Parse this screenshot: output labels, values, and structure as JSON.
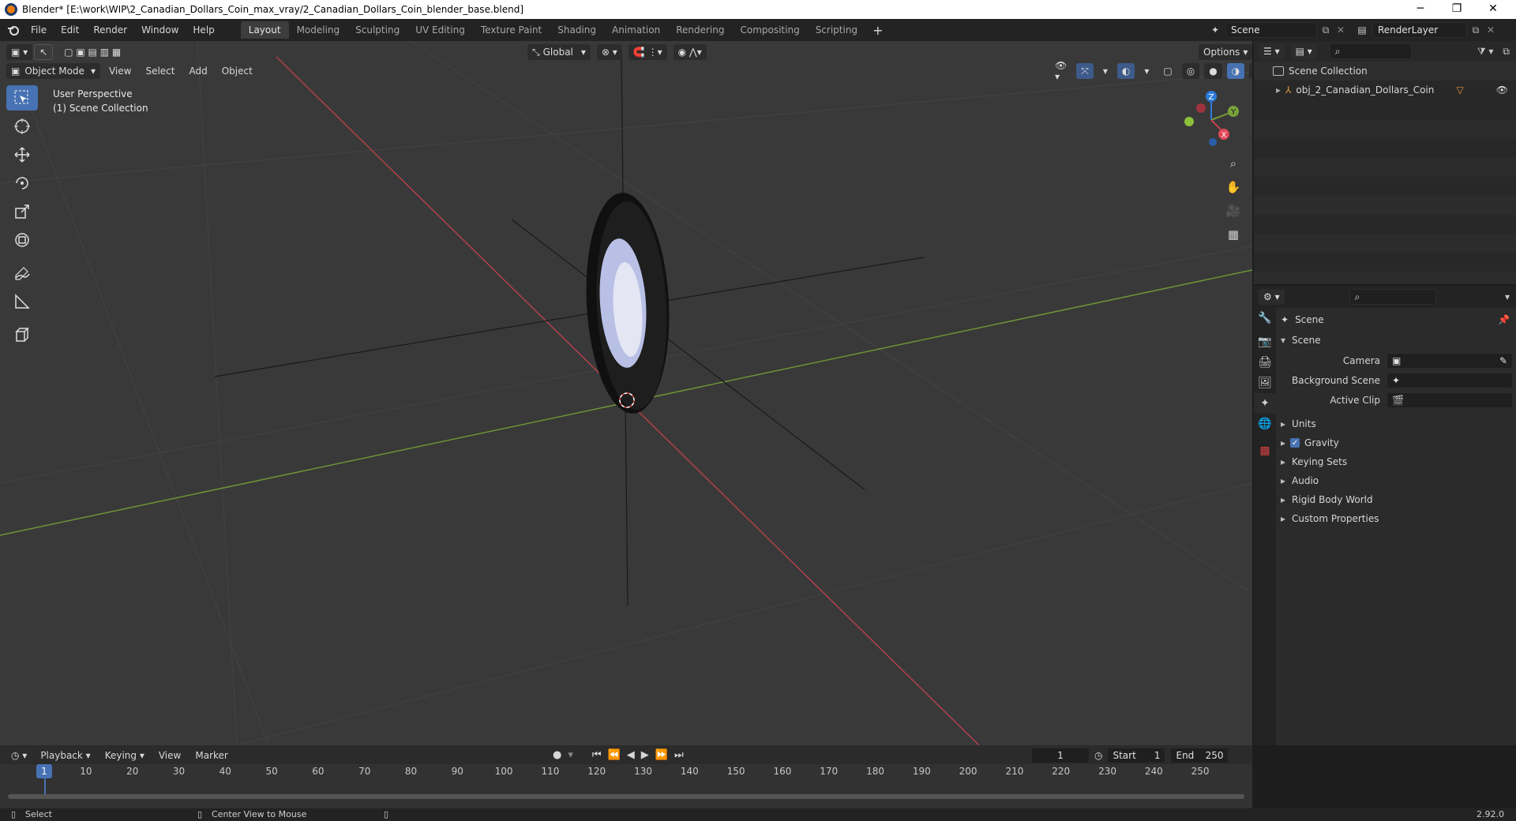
{
  "window": {
    "title": "Blender* [E:\\work\\WIP\\2_Canadian_Dollars_Coin_max_vray/2_Canadian_Dollars_Coin_blender_base.blend]"
  },
  "menu": [
    "File",
    "Edit",
    "Render",
    "Window",
    "Help"
  ],
  "workspaces": [
    "Layout",
    "Modeling",
    "Sculpting",
    "UV Editing",
    "Texture Paint",
    "Shading",
    "Animation",
    "Rendering",
    "Compositing",
    "Scripting"
  ],
  "scene_name": "Scene",
  "view_layer": "RenderLayer",
  "viewport": {
    "mode": "Object Mode",
    "menus": [
      "View",
      "Select",
      "Add",
      "Object"
    ],
    "transform_orientation": "Global",
    "options_label": "Options",
    "overlay_line1": "User Perspective",
    "overlay_line2": "(1) Scene Collection",
    "gizmo_axes": {
      "z": "Z",
      "y": "Y",
      "x": "X"
    }
  },
  "outliner": {
    "root": "Scene Collection",
    "items": [
      {
        "label": "obj_2_Canadian_Dollars_Coin"
      }
    ]
  },
  "properties": {
    "header": "Scene",
    "panel": "Scene",
    "fields": [
      {
        "label": "Camera"
      },
      {
        "label": "Background Scene"
      },
      {
        "label": "Active Clip"
      }
    ],
    "sections": [
      "Units",
      "Gravity",
      "Keying Sets",
      "Audio",
      "Rigid Body World",
      "Custom Properties"
    ],
    "gravity_checked": true
  },
  "timeline": {
    "menus": [
      "Playback",
      "Keying",
      "View",
      "Marker"
    ],
    "current_frame": "1",
    "start_label": "Start",
    "start": "1",
    "end_label": "End",
    "end": "250",
    "ticks": [
      "1",
      "10",
      "20",
      "30",
      "40",
      "50",
      "60",
      "70",
      "80",
      "90",
      "100",
      "110",
      "120",
      "130",
      "140",
      "150",
      "160",
      "170",
      "180",
      "190",
      "200",
      "210",
      "220",
      "230",
      "240",
      "250"
    ]
  },
  "statusbar": {
    "left": "Select",
    "middle": "Center View to Mouse",
    "version": "2.92.0"
  },
  "colors": {
    "accent": "#4772b3",
    "x_axis": "#c4424a",
    "y_axis": "#7aa23a",
    "z_axis": "#2e7bd9"
  }
}
